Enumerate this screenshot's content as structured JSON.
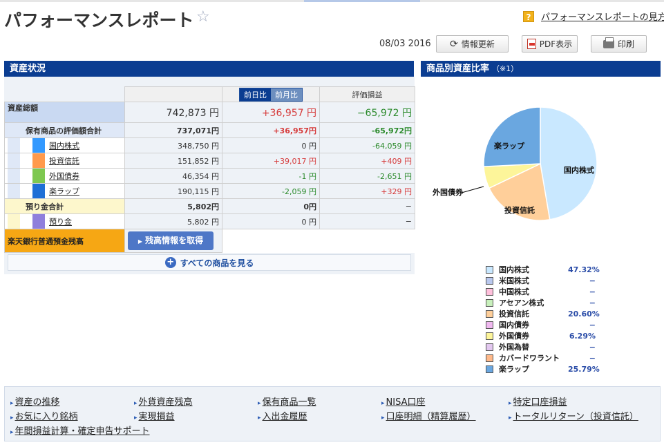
{
  "page": {
    "title": "パフォーマンスレポート",
    "help_link": "パフォーマンスレポートの見方",
    "date": "08/03 2016",
    "buttons": {
      "refresh": "情報更新",
      "pdf": "PDF表示",
      "print": "印刷"
    }
  },
  "assets": {
    "section_title": "資産状況",
    "tabs": {
      "day": "前日比",
      "month": "前月比"
    },
    "header_pl": "評価損益",
    "total": {
      "label": "資産総額",
      "value": "742,873 円",
      "change": "+36,957 円",
      "pl": "−65,972 円"
    },
    "holdings": {
      "label": "保有商品の評価額合計",
      "value": "737,071円",
      "change": "+36,957円",
      "pl": "-65,972円"
    },
    "items": [
      {
        "label": "国内株式",
        "value": "348,750 円",
        "change": "0 円",
        "pl": "-64,059 円",
        "color": "#3399ff",
        "change_type": "zero",
        "pl_type": "neg"
      },
      {
        "label": "投資信託",
        "value": "151,852 円",
        "change": "+39,017 円",
        "pl": "+409 円",
        "color": "#ff9a4d",
        "change_type": "pos",
        "pl_type": "pos"
      },
      {
        "label": "外国債券",
        "value": "46,354 円",
        "change": "-1 円",
        "pl": "-2,651 円",
        "color": "#7ec850",
        "change_type": "neg",
        "pl_type": "neg"
      },
      {
        "label": "楽ラップ",
        "value": "190,115 円",
        "change": "-2,059 円",
        "pl": "+329 円",
        "color": "#1e6fd6",
        "change_type": "neg",
        "pl_type": "pos"
      }
    ],
    "cash": {
      "label": "預り金合計",
      "value": "5,802円",
      "change": "0円",
      "pl": "−"
    },
    "cash_items": [
      {
        "label": "預り金",
        "value": "5,802 円",
        "change": "0 円",
        "pl": "−",
        "color": "#8f7fdc"
      }
    ],
    "bank": {
      "label": "楽天銀行普通預金残高",
      "button": "残高情報を取得"
    },
    "see_all": "すべての商品を見る"
  },
  "ratio": {
    "section_title": "商品別資産比率",
    "note": "（※1）",
    "pie_labels": {
      "domestic": "国内株式",
      "fund": "投資信託",
      "bond": "外国債券",
      "wrap": "楽ラップ"
    },
    "legend": [
      {
        "name": "国内株式",
        "value": "47.32%",
        "color": "#c9e8ff"
      },
      {
        "name": "米国株式",
        "value": "−",
        "color": "#b9c8ee"
      },
      {
        "name": "中国株式",
        "value": "−",
        "color": "#ffc0dc"
      },
      {
        "name": "アセアン株式",
        "value": "−",
        "color": "#c8f0bc"
      },
      {
        "name": "投資信託",
        "value": "20.60%",
        "color": "#ffcf9a"
      },
      {
        "name": "国内債券",
        "value": "−",
        "color": "#f0b9f0"
      },
      {
        "name": "外国債券",
        "value": "6.29%",
        "color": "#fdf59a"
      },
      {
        "name": "外国為替",
        "value": "−",
        "color": "#e3c8f0"
      },
      {
        "name": "カバードワラント",
        "value": "−",
        "color": "#ffb98a"
      },
      {
        "name": "楽ラップ",
        "value": "25.79%",
        "color": "#6aa7e0"
      }
    ]
  },
  "chart_data": {
    "type": "pie",
    "categories": [
      "国内株式",
      "投資信託",
      "外国債券",
      "楽ラップ"
    ],
    "values": [
      47.32,
      20.6,
      6.29,
      25.79
    ],
    "colors": [
      "#c9e8ff",
      "#ffcf9a",
      "#fdf59a",
      "#6aa7e0"
    ]
  },
  "links": [
    "資産の推移",
    "外貨資産残高",
    "保有商品一覧",
    "NISA口座",
    "特定口座損益",
    "お気に入り銘柄",
    "実現損益",
    "入出金履歴",
    "口座明細（精算履歴）",
    "トータルリターン（投資信託）",
    "年間損益計算・確定申告サポート"
  ]
}
